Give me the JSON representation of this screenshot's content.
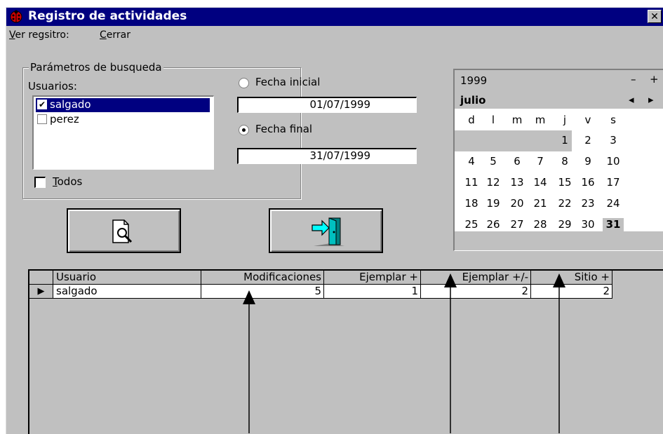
{
  "window": {
    "title": "Registro de actividades",
    "close_label": "✕",
    "title_bg": "#000080",
    "face_color": "#c0c0c0"
  },
  "menu": {
    "items": [
      {
        "label": "Ver regsitro:",
        "hotkey": "V"
      },
      {
        "label": "Cerrar",
        "hotkey": "C"
      }
    ]
  },
  "search": {
    "group_label": "Parámetros de busqueda",
    "users_label": "Usuarios:",
    "users": [
      {
        "name": "salgado",
        "checked": true,
        "selected": true
      },
      {
        "name": "perez",
        "checked": false,
        "selected": false
      }
    ],
    "all_label": "Todos",
    "all_checked": false,
    "start_date_label": "Fecha inicial",
    "start_date_value": "01/07/1999",
    "start_date_selected": false,
    "end_date_label": "Fecha final",
    "end_date_value": "31/07/1999",
    "end_date_selected": true
  },
  "buttons": {
    "search_icon": "magnifier-document-icon",
    "exit_icon": "exit-door-icon"
  },
  "calendar": {
    "year": "1999",
    "month": "julio",
    "year_dec": "–",
    "year_inc": "+",
    "month_prev": "◂",
    "month_next": "▸",
    "weekdays": [
      "d",
      "l",
      "m",
      "m",
      "j",
      "v",
      "s"
    ],
    "weeks": [
      [
        "",
        "",
        "",
        "",
        "1",
        "2",
        "3"
      ],
      [
        "4",
        "5",
        "6",
        "7",
        "8",
        "9",
        "10"
      ],
      [
        "11",
        "12",
        "13",
        "14",
        "15",
        "16",
        "17"
      ],
      [
        "18",
        "19",
        "20",
        "21",
        "22",
        "23",
        "24"
      ],
      [
        "25",
        "26",
        "27",
        "28",
        "29",
        "30",
        "31"
      ]
    ],
    "selected_day": "31"
  },
  "grid": {
    "columns": [
      "Usuario",
      "Modificaciones",
      "Ejemplar +",
      "Ejemplar +/-",
      "Sitio +"
    ],
    "rows": [
      {
        "indicator": "▶",
        "cells": [
          "salgado",
          "5",
          "1",
          "2",
          "2"
        ]
      }
    ]
  }
}
